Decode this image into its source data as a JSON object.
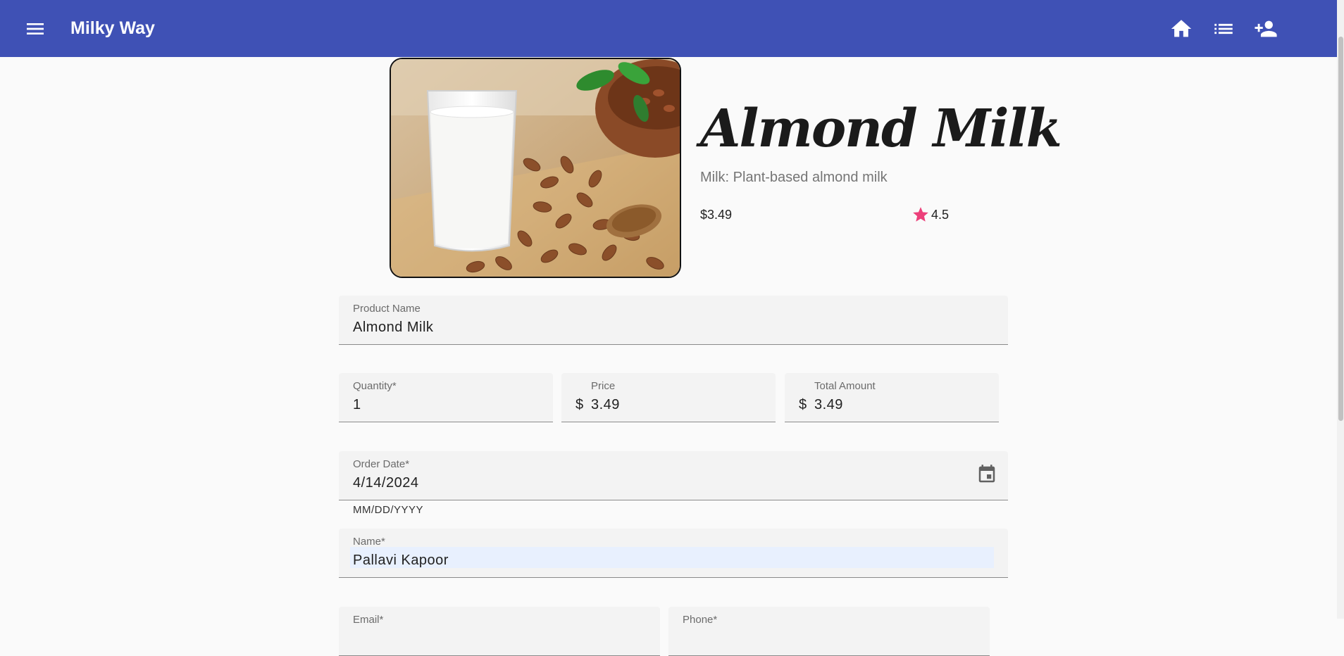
{
  "app": {
    "title": "Milky Way",
    "menu_icon": "menu-icon",
    "toolbar_icons": [
      "home-icon",
      "list-icon",
      "person-add-icon"
    ],
    "brand_color": "#3f51b5"
  },
  "product": {
    "name": "Almond Milk",
    "subtitle": "Milk: Plant-based almond milk",
    "price": "$3.49",
    "rating": "4.5",
    "rating_color": "#ec407a"
  },
  "form": {
    "product_name": {
      "label": "Product Name",
      "value": "Almond Milk"
    },
    "quantity": {
      "label": "Quantity*",
      "value": "1"
    },
    "price": {
      "label": "Price",
      "prefix": "$",
      "value": "3.49"
    },
    "total": {
      "label": "Total Amount",
      "prefix": "$",
      "value": "3.49"
    },
    "order_date": {
      "label": "Order Date*",
      "value": "4/14/2024",
      "hint": "MM/DD/YYYY"
    },
    "name": {
      "label": "Name*",
      "value": "Pallavi Kapoor"
    },
    "email": {
      "label": "Email*"
    },
    "phone": {
      "label": "Phone*"
    }
  }
}
